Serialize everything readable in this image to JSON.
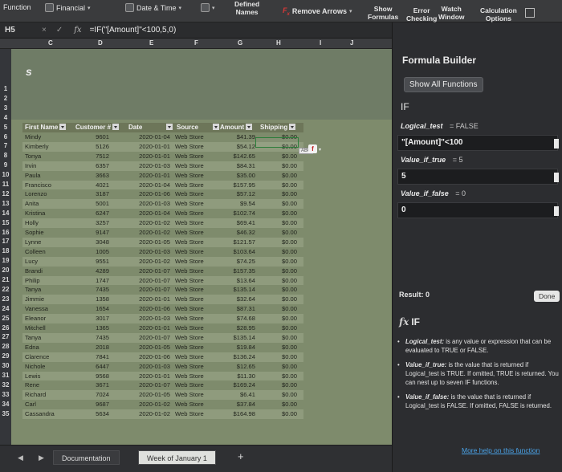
{
  "ribbon": {
    "function_label": "Function",
    "financial_label": "Financial",
    "datetime_label": "Date & Time",
    "defined_names_line1": "Defined",
    "defined_names_line2": "Names",
    "remove_arrows_label": "Remove Arrows",
    "show_formulas_line1": "Show",
    "show_formulas_line2": "Formulas",
    "error_checking_line1": "Error",
    "error_checking_line2": "Checking",
    "watch_window_line1": "Watch",
    "watch_window_line2": "Window",
    "calc_options_line1": "Calculation",
    "calc_options_line2": "Options",
    "accent_color": "#d93838"
  },
  "formula_bar": {
    "name_box": "H5",
    "cancel_icon": "×",
    "enter_icon": "✓",
    "fx_icon": "fx",
    "formula": "=IF(\"[Amount]\"<100,5,0)"
  },
  "columns": [
    "C",
    "D",
    "E",
    "F",
    "G",
    "H",
    "I",
    "J"
  ],
  "rows": [
    "1",
    "2",
    "3",
    "4",
    "5",
    "6",
    "7",
    "8",
    "9",
    "10",
    "11",
    "12",
    "13",
    "14",
    "15",
    "16",
    "17",
    "18",
    "19",
    "20",
    "21",
    "22",
    "23",
    "24",
    "25",
    "26",
    "27",
    "28",
    "29",
    "30",
    "31",
    "32",
    "33",
    "34",
    "35"
  ],
  "sheet": {
    "banner_text": "s",
    "headers": [
      "First Name",
      "Customer #",
      "Date",
      "Source",
      "Amount",
      "Shipping"
    ],
    "data": [
      [
        "Mindy",
        "9601",
        "2020-01-04",
        "Web Store",
        "$41.39",
        "$0.00"
      ],
      [
        "Kimberly",
        "5126",
        "2020-01-01",
        "Web Store",
        "$54.12",
        "$0.00"
      ],
      [
        "Tonya",
        "7512",
        "2020-01-01",
        "Web Store",
        "$142.65",
        "$0.00"
      ],
      [
        "Irvin",
        "6357",
        "2020-01-03",
        "Web Store",
        "$84.31",
        "$0.00"
      ],
      [
        "Paula",
        "3663",
        "2020-01-01",
        "Web Store",
        "$35.00",
        "$0.00"
      ],
      [
        "Francisco",
        "4021",
        "2020-01-04",
        "Web Store",
        "$157.95",
        "$0.00"
      ],
      [
        "Lorenzo",
        "3187",
        "2020-01-06",
        "Web Store",
        "$57.12",
        "$0.00"
      ],
      [
        "Anita",
        "5001",
        "2020-01-03",
        "Web Store",
        "$9.54",
        "$0.00"
      ],
      [
        "Kristina",
        "6247",
        "2020-01-04",
        "Web Store",
        "$102.74",
        "$0.00"
      ],
      [
        "Holly",
        "3257",
        "2020-01-02",
        "Web Store",
        "$69.41",
        "$0.00"
      ],
      [
        "Sophie",
        "9147",
        "2020-01-02",
        "Web Store",
        "$46.32",
        "$0.00"
      ],
      [
        "Lynne",
        "3048",
        "2020-01-05",
        "Web Store",
        "$121.57",
        "$0.00"
      ],
      [
        "Colleen",
        "1005",
        "2020-01-03",
        "Web Store",
        "$103.64",
        "$0.00"
      ],
      [
        "Lucy",
        "9551",
        "2020-01-02",
        "Web Store",
        "$74.25",
        "$0.00"
      ],
      [
        "Brandi",
        "4289",
        "2020-01-07",
        "Web Store",
        "$157.35",
        "$0.00"
      ],
      [
        "Philip",
        "1747",
        "2020-01-07",
        "Web Store",
        "$13.64",
        "$0.00"
      ],
      [
        "Tanya",
        "7435",
        "2020-01-07",
        "Web Store",
        "$135.14",
        "$0.00"
      ],
      [
        "Jimmie",
        "1358",
        "2020-01-01",
        "Web Store",
        "$32.64",
        "$0.00"
      ],
      [
        "Vanessa",
        "1654",
        "2020-01-06",
        "Web Store",
        "$87.31",
        "$0.00"
      ],
      [
        "Eleanor",
        "3017",
        "2020-01-03",
        "Web Store",
        "$74.68",
        "$0.00"
      ],
      [
        "Mitchell",
        "1365",
        "2020-01-01",
        "Web Store",
        "$28.95",
        "$0.00"
      ],
      [
        "Tanya",
        "7435",
        "2020-01-07",
        "Web Store",
        "$135.14",
        "$0.00"
      ],
      [
        "Edna",
        "2018",
        "2020-01-05",
        "Web Store",
        "$19.84",
        "$0.00"
      ],
      [
        "Clarence",
        "7841",
        "2020-01-06",
        "Web Store",
        "$136.24",
        "$0.00"
      ],
      [
        "Nichole",
        "6447",
        "2020-01-03",
        "Web Store",
        "$12.65",
        "$0.00"
      ],
      [
        "Lewis",
        "9568",
        "2020-01-01",
        "Web Store",
        "$11.30",
        "$0.00"
      ],
      [
        "Rene",
        "3671",
        "2020-01-07",
        "Web Store",
        "$169.24",
        "$0.00"
      ],
      [
        "Richard",
        "7024",
        "2020-01-05",
        "Web Store",
        "$6.41",
        "$0.00"
      ],
      [
        "Carl",
        "9687",
        "2020-01-02",
        "Web Store",
        "$37.84",
        "$0.00"
      ],
      [
        "Cassandra",
        "5634",
        "2020-01-02",
        "Web Store",
        "$164.98",
        "$0.00"
      ]
    ],
    "abc_tag": "ABC",
    "fx_badge": "f"
  },
  "tabs": {
    "documentation": "Documentation",
    "week1": "Week of January 1",
    "add": "+"
  },
  "panel": {
    "title": "Formula Builder",
    "show_all": "Show All Functions",
    "function": "IF",
    "logical_test_label": "Logical_test",
    "logical_test_eval": "= FALSE",
    "logical_test_value": "\"[Amount]\"<100",
    "value_if_true_label": "Value_if_true",
    "value_if_true_eval": "= 5",
    "value_if_true_value": "5",
    "value_if_false_label": "Value_if_false",
    "value_if_false_eval": "= 0",
    "value_if_false_value": "0",
    "result_label": "Result: 0",
    "done_label": "Done",
    "help_heading": "IF",
    "help": [
      {
        "term": "Logical_test:",
        "text": " is any value or expression that can be evaluated to TRUE or FALSE."
      },
      {
        "term": "Value_if_true:",
        "text": " is the value that is returned if Logical_test is TRUE. If omitted, TRUE is returned. You can nest up to seven IF functions."
      },
      {
        "term": "Value_if_false:",
        "text": " is the value that is returned if Logical_test is FALSE. If omitted, FALSE is returned."
      }
    ],
    "more_help": "More help on this function"
  }
}
